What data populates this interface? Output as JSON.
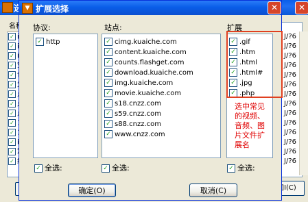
{
  "background": {
    "title": "选择",
    "column_header": "名称",
    "rows": [
      "ind",
      "ind",
      "ind",
      "空i",
      "色i",
      "爱i",
      "点i",
      "点i",
      "点i",
      "12:",
      "190",
      "ind",
      "家i",
      "绿4"
    ],
    "right_col": [
      "J/?6",
      "J/?6",
      "J/?6",
      "J/?6",
      "J/?6",
      "J/?6",
      "J/?6",
      "J/?6",
      "J/?6",
      "J/?6",
      "J/?6",
      "J/?6",
      "J/?6",
      "J/?6"
    ],
    "button_right": "]I(C)"
  },
  "dialog": {
    "title": "扩展选择",
    "protocol": {
      "label": "协议:",
      "items": [
        "http"
      ],
      "select_all": "全选:"
    },
    "site": {
      "label": "站点:",
      "items": [
        "cimg.kuaiche.com",
        "content.kuaiche.com",
        "counts.flashget.com",
        "download.kuaiche.com",
        "img.kuaiche.com",
        "movie.kuaiche.com",
        "s18.cnzz.com",
        "s59.cnzz.com",
        "s88.cnzz.com",
        "www.cnzz.com"
      ],
      "select_all": "全选:"
    },
    "extension": {
      "label": "扩展",
      "items": [
        ".gif",
        ".htm",
        ".html",
        ".html#",
        ".jpg",
        ".php"
      ],
      "select_all": "全选:"
    },
    "annotation": "选中常见的视频、音频、图片文件扩展名",
    "ok_label": "确定(O)",
    "cancel_label": "取消(C)"
  }
}
